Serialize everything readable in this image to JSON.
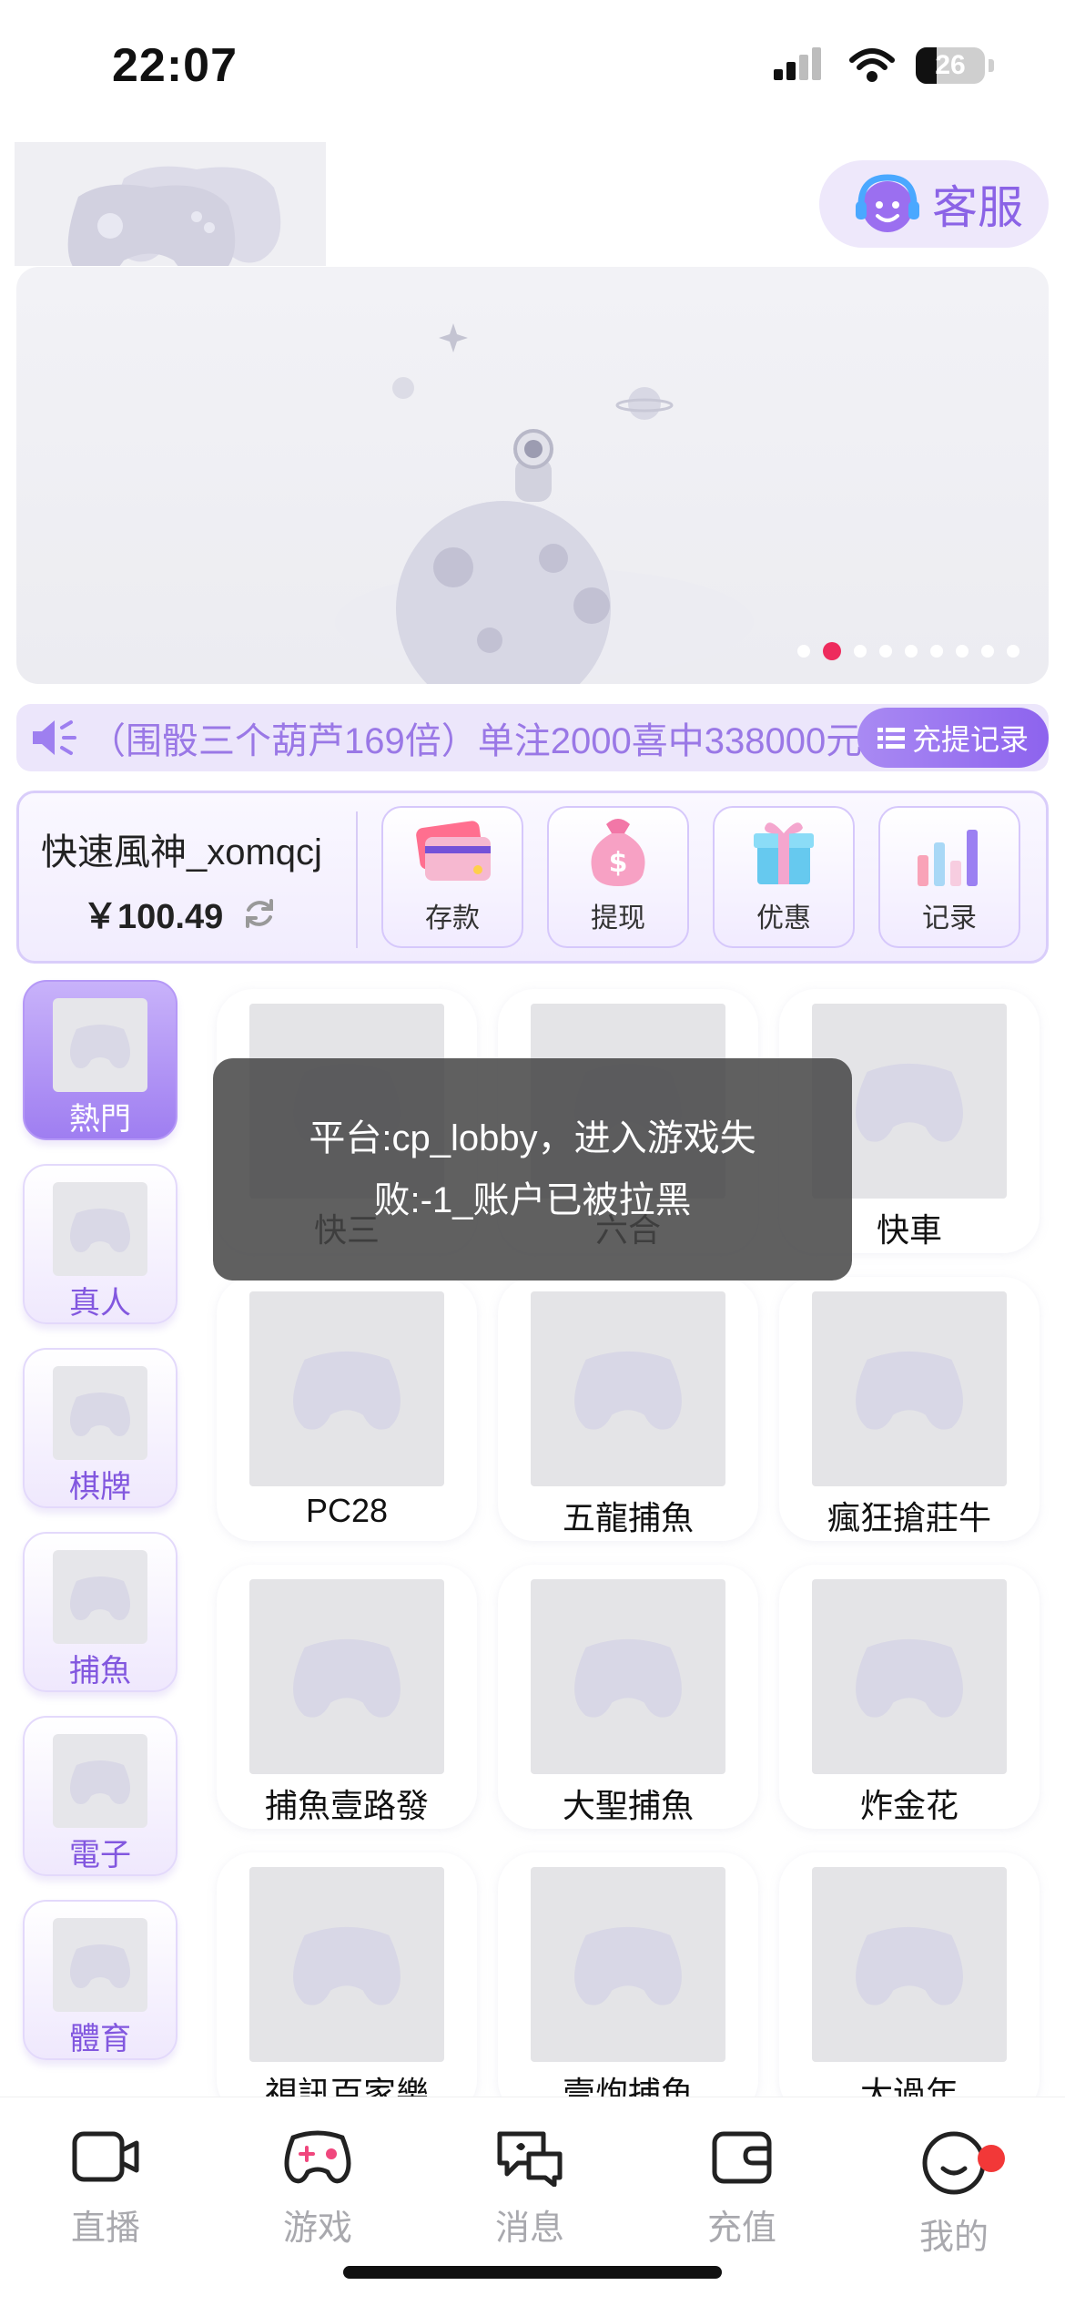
{
  "status_bar": {
    "time": "22:07",
    "battery": "26"
  },
  "header": {
    "service_label": "客服"
  },
  "banner": {
    "dot_count": 9,
    "active_dot": 1
  },
  "marquee": {
    "text": "（围骰三个葫芦169倍）单注2000喜中338000元",
    "record_label": "充提记录"
  },
  "user": {
    "name": "快速風神_xomqcj",
    "balance": "￥100.49"
  },
  "actions": [
    {
      "label": "存款",
      "icon": "card-icon"
    },
    {
      "label": "提现",
      "icon": "money-bag-icon"
    },
    {
      "label": "优惠",
      "icon": "gift-icon"
    },
    {
      "label": "记录",
      "icon": "bar-chart-icon"
    }
  ],
  "categories": [
    {
      "label": "熱門",
      "active": true
    },
    {
      "label": "真人"
    },
    {
      "label": "棋牌"
    },
    {
      "label": "捕魚"
    },
    {
      "label": "電子"
    },
    {
      "label": "體育"
    }
  ],
  "games": [
    {
      "label": "快三"
    },
    {
      "label": "六合"
    },
    {
      "label": "快車"
    },
    {
      "label": "PC28"
    },
    {
      "label": "五龍捕魚"
    },
    {
      "label": "瘋狂搶莊牛"
    },
    {
      "label": "捕魚壹路發"
    },
    {
      "label": "大聖捕魚"
    },
    {
      "label": "炸金花"
    },
    {
      "label": "視訊百家樂"
    },
    {
      "label": "壹炮捕魚"
    },
    {
      "label": "大過年"
    }
  ],
  "toast": {
    "message": "平台:cp_lobby，进入游戏失败:-1_账户已被拉黑"
  },
  "bottom_nav": [
    {
      "label": "直播",
      "icon": "camera-icon"
    },
    {
      "label": "游戏",
      "icon": "gamepad-icon"
    },
    {
      "label": "消息",
      "icon": "chat-icon"
    },
    {
      "label": "充值",
      "icon": "wallet-icon"
    },
    {
      "label": "我的",
      "icon": "smile-icon"
    }
  ],
  "colors": {
    "accent": "#8b63e6",
    "active_dot": "#ee2b5d",
    "badge": "#f23838"
  }
}
